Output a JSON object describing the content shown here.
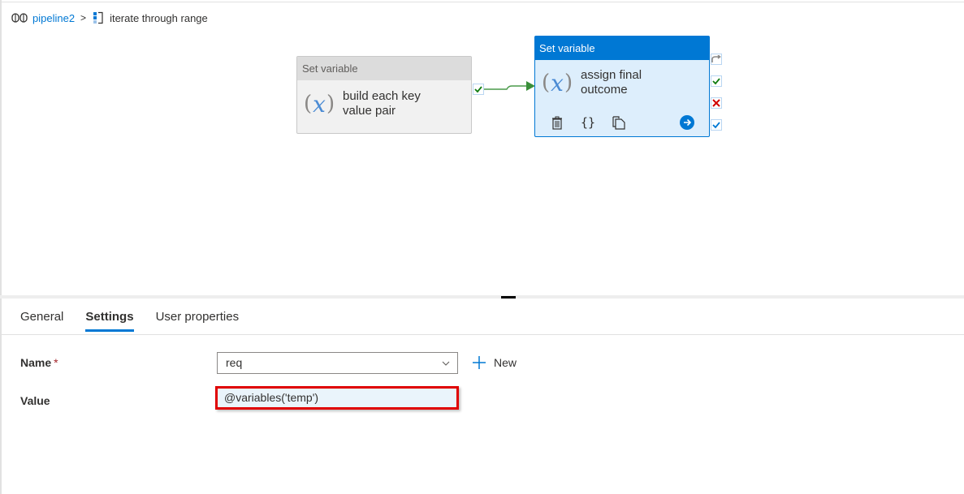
{
  "breadcrumb": {
    "pipeline_icon": "pipeline-icon",
    "pipeline": "pipeline2",
    "separator": ">",
    "activity_icon": "foreach-icon",
    "current": "iterate through range"
  },
  "canvas": {
    "activities": [
      {
        "type": "Set variable",
        "name_line1": "build each key",
        "name_line2": "value pair",
        "icon": "variable-fx-icon",
        "selected": false,
        "output_port": "success-port"
      },
      {
        "type": "Set variable",
        "name_line1": "assign final",
        "name_line2": "outcome",
        "icon": "variable-fx-icon",
        "selected": true,
        "toolbar": [
          "delete-icon",
          "code-braces-icon",
          "copy-icon",
          "go-arrow-icon"
        ],
        "ports": [
          "skip-port",
          "success-port",
          "failure-port",
          "completion-port"
        ]
      }
    ],
    "connector": {
      "from": "build each key value pair",
      "to": "assign final outcome",
      "condition": "success"
    }
  },
  "tabs": [
    {
      "label": "General",
      "active": false
    },
    {
      "label": "Settings",
      "active": true
    },
    {
      "label": "User properties",
      "active": false
    }
  ],
  "form": {
    "name_label": "Name",
    "required_mark": "*",
    "name_value": "req",
    "new_label": "New",
    "value_label": "Value",
    "value_value": "@variables('temp')"
  },
  "colors": {
    "accent": "#0078d4",
    "success": "#107c10",
    "failure": "#d00000",
    "highlight_border": "#e00000"
  }
}
